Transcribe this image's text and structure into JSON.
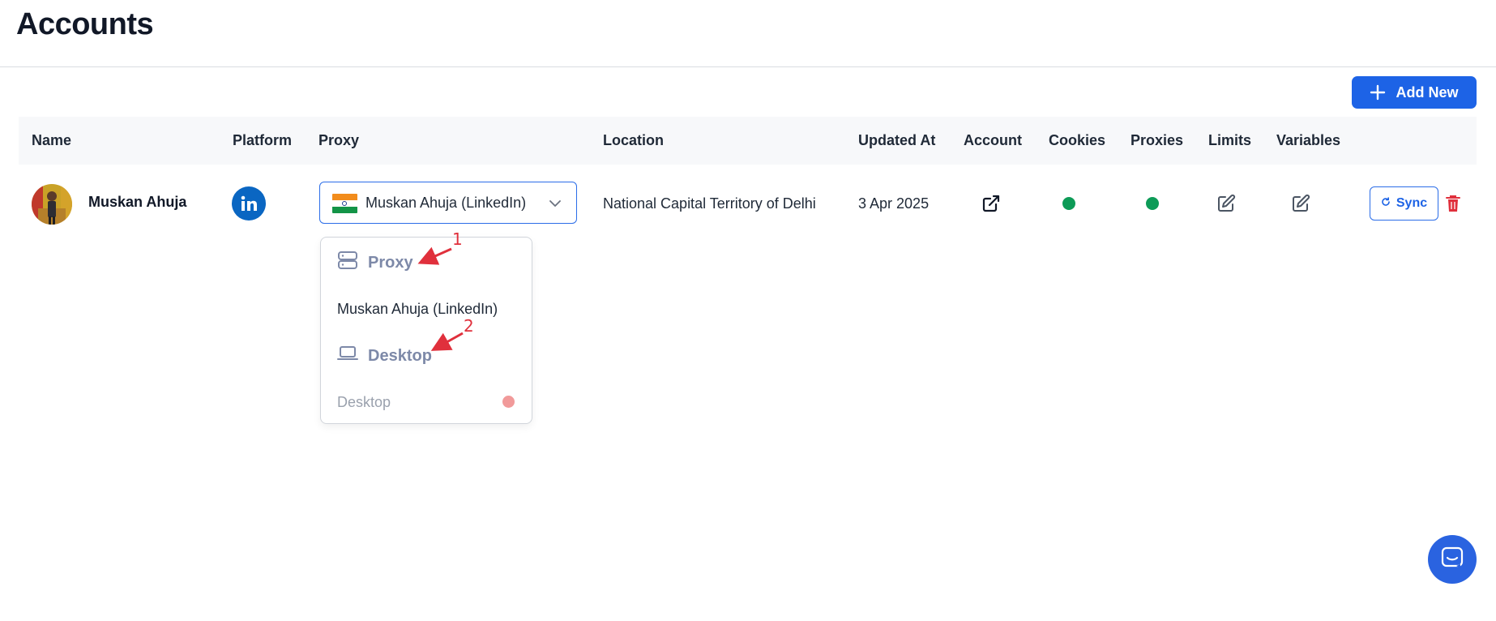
{
  "page": {
    "title": "Accounts"
  },
  "toolbar": {
    "add_new_label": "Add New"
  },
  "table": {
    "columns": [
      "Name",
      "Platform",
      "Proxy",
      "Location",
      "Updated At",
      "Account",
      "Cookies",
      "Proxies",
      "Limits",
      "Variables"
    ],
    "rows": [
      {
        "name": "Muskan Ahuja",
        "platform": "linkedin-icon",
        "proxy": "Muskan Ahuja (LinkedIn)",
        "location": "National Capital Territory of Delhi",
        "updated_at": "3 Apr 2025",
        "cookies_status": "green",
        "proxies_status": "green",
        "sync_label": "Sync"
      }
    ]
  },
  "proxy_dropdown": {
    "groups": [
      {
        "label": "Proxy",
        "icon": "server-icon",
        "options": [
          {
            "label": "Muskan Ahuja (LinkedIn)"
          }
        ]
      },
      {
        "label": "Desktop",
        "icon": "laptop-icon",
        "options": [
          {
            "label": "Desktop",
            "status_color": "#f19a9a"
          }
        ]
      }
    ]
  },
  "annotations": [
    {
      "label": "1"
    },
    {
      "label": "2"
    }
  ],
  "colors": {
    "accent": "#1d63e6",
    "status_green": "#0d9b57",
    "danger": "#e0303c",
    "linkedin": "#0a66c2"
  }
}
